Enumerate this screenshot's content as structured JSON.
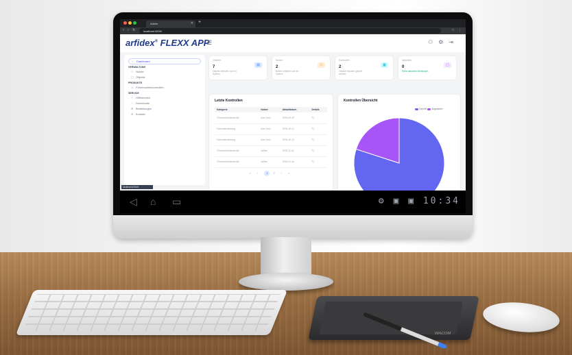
{
  "browser": {
    "tab_title": "Admin",
    "url": "localhost:4200/"
  },
  "app": {
    "brand": "arfidex",
    "brand_mark": "®",
    "brand_suffix": " FLEXX APP",
    "menu_icon": "hamburger-icon"
  },
  "sidebar": {
    "dashboard": "Dashboard",
    "groups": [
      {
        "heading": "VERWALTUNG",
        "items": [
          "Nutzer",
          "Objekte"
        ]
      },
      {
        "heading": "PRODUKTE",
        "items": [
          "Führerscheinkontrollen"
        ]
      },
      {
        "heading": "SERVICE",
        "items": [
          "Hilfebereich",
          "Downloads",
          "Bestellungen",
          "Kontakt"
        ]
      }
    ]
  },
  "stats": [
    {
      "title": "Objekte",
      "value": "7",
      "sub": "Objekte befinden sich im System",
      "icon_color": "#3b82f6",
      "icon_bg": "#dbeafe"
    },
    {
      "title": "Nutzer",
      "value": "2",
      "sub": "Nutzer befinden sich im System",
      "icon_color": "#f97316",
      "icon_bg": "#ffedd5"
    },
    {
      "title": "Kontrollen",
      "value": "2",
      "sub": "Objekte müssen geprüft werden",
      "icon_color": "#06b6d4",
      "icon_bg": "#cffafe"
    },
    {
      "title": "Aktuelles",
      "value": "0",
      "sub": "Siehe aktuellen Meldungen",
      "icon_color": "#a855f7",
      "icon_bg": "#f3e8ff"
    }
  ],
  "table": {
    "title": "Letzte Kontrollen",
    "columns": [
      "Kategorie",
      "Nutzer",
      "Ablaufdatum",
      "Details"
    ],
    "rows": [
      [
        "Führerscheinkontrolle",
        "Irian Solo",
        "2025-05-25"
      ],
      [
        "Fahrunterweisung",
        "Irian Solo",
        "2025-10-01"
      ],
      [
        "Fahrunterweisung",
        "Irian Solo",
        "2025-10-13"
      ],
      [
        "Führerscheinkontrolle",
        "zabba",
        "2025-11-01"
      ],
      [
        "Führerscheinkontrolle",
        "zabba",
        "2026-01-16"
      ]
    ],
    "pager": {
      "first": "«",
      "prev": "‹",
      "current": "1",
      "next_page": "2",
      "next": "›",
      "last": "»"
    }
  },
  "chart_data": {
    "type": "pie",
    "title": "Kontrollen Übersicht",
    "labels": [
      "Geprüft",
      "Abgelaufen"
    ],
    "values": [
      80,
      20
    ],
    "colors": [
      "#6366f1",
      "#a855f7"
    ],
    "legend": "top-right"
  },
  "status_chip": "localhost:4200/#",
  "clock": "10:34",
  "tablet_brand": "WACOM"
}
